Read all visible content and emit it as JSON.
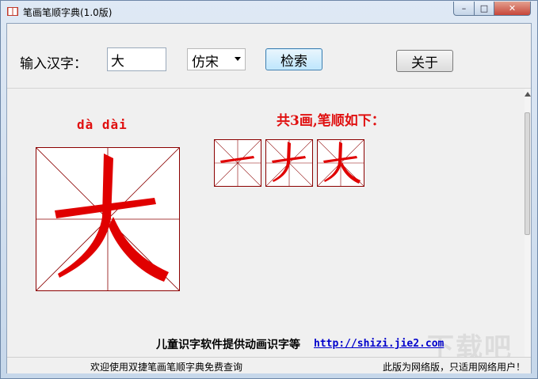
{
  "window": {
    "title": "笔画笔顺字典(1.0版)",
    "controls": {
      "minimize": "–",
      "maximize": "□",
      "close": "✕"
    }
  },
  "toolbar": {
    "input_label": "输入汉字：",
    "input_value": "大",
    "font_value": "仿宋",
    "search_label": "检索",
    "about_label": "关于"
  },
  "result": {
    "pinyin": "dà dài",
    "character": "大",
    "stroke_count_text": "共3画,笔顺如下：",
    "stroke_steps": 3,
    "stroke_color": "#e00000",
    "grid_color": "#8b0000"
  },
  "promo": {
    "text": "儿童识字软件提供动画识字等",
    "link": "http://shizi.jie2.com"
  },
  "watermark": "下载吧",
  "status": {
    "left": "欢迎使用双捷笔画笔顺字典免费查询",
    "right": "此版为网络版，只适用网络用户！"
  }
}
